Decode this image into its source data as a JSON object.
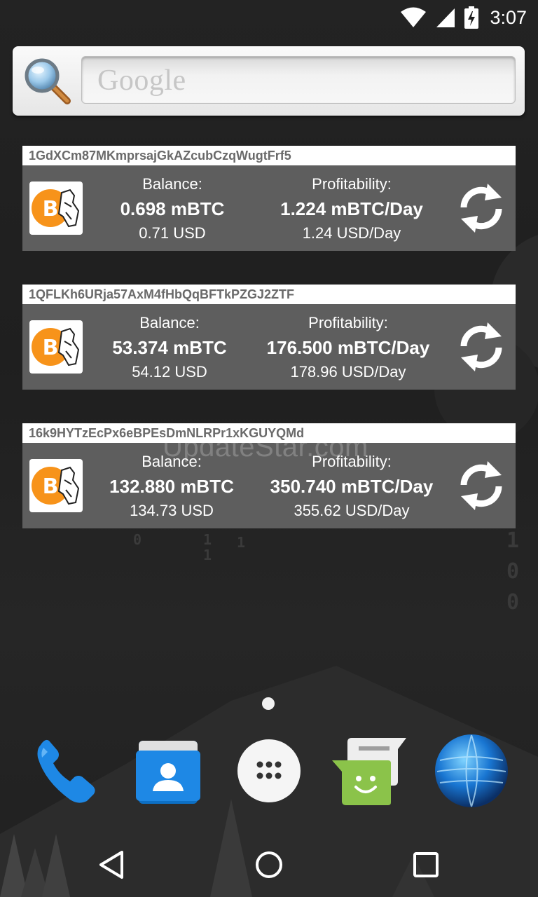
{
  "status_bar": {
    "time": "3:07",
    "icons": [
      "wifi-icon",
      "signal-icon",
      "battery-charging-icon"
    ]
  },
  "search_widget": {
    "placeholder": "Google",
    "icons": [
      "magnifier-icon"
    ]
  },
  "wallets": [
    {
      "address": "1GdXCm87MKmprsajGkAZcubCzqWugtFrf5",
      "balance_label": "Balance:",
      "balance": "0.698 mBTC",
      "balance_usd": "0.71 USD",
      "profit_label": "Profitability:",
      "profit": "1.224 mBTC/Day",
      "profit_usd": "1.24 USD/Day"
    },
    {
      "address": "1QFLKh6URja57AxM4fHbQqBFTkPZGJ2ZTF",
      "balance_label": "Balance:",
      "balance": "53.374 mBTC",
      "balance_usd": "54.12 USD",
      "profit_label": "Profitability:",
      "profit": "176.500 mBTC/Day",
      "profit_usd": "178.96 USD/Day"
    },
    {
      "address": "16k9HYTzEcPx6eBPEsDmNLRPr1xKGUYQMd",
      "balance_label": "Balance:",
      "balance": "132.880 mBTC",
      "balance_usd": "134.73 USD",
      "profit_label": "Profitability:",
      "profit": "350.740 mBTC/Day",
      "profit_usd": "355.62 USD/Day"
    }
  ],
  "watermark": "UpdateStar.com",
  "wallpaper_digits": {
    "right_column": [
      "1",
      "0",
      "0"
    ],
    "scattered": [
      "0",
      "1",
      "1",
      "1"
    ]
  },
  "dock": [
    "phone-icon",
    "contacts-icon",
    "app-drawer-icon",
    "messaging-icon",
    "browser-globe-icon"
  ],
  "nav": [
    "back-icon",
    "home-icon",
    "recents-icon"
  ],
  "colors": {
    "widget_body": "#5e5e5e",
    "bitcoin_orange": "#f7931a",
    "phone_blue": "#1e88e5",
    "messaging_green": "#8bc34a"
  }
}
